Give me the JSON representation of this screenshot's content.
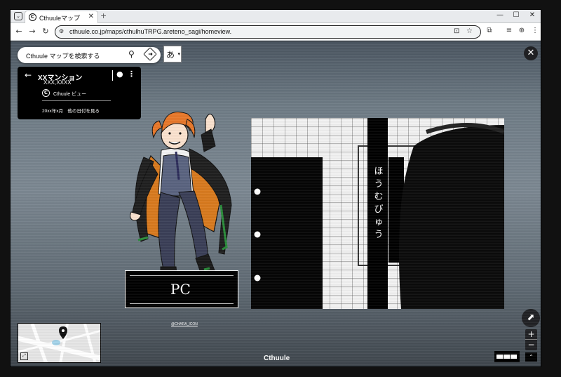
{
  "browser": {
    "tab_title": "Cthuuleマップ",
    "tab_close": "✕",
    "new_tab": "+",
    "url": "cthuule.co.jp/maps/cthulhuTRPG.areteno_sagi/homeview.",
    "window_controls": {
      "minimize": "—",
      "maximize": "☐",
      "close": "✕"
    },
    "nav": {
      "back": "←",
      "forward": "→",
      "reload": "↻"
    }
  },
  "search": {
    "placeholder": "Cthuule マップを検索する"
  },
  "ime": {
    "mode": "あ",
    "arrow": "▾"
  },
  "close_panorama": "✕",
  "info_card": {
    "back": "←",
    "title": "XXマンション",
    "address": "XXX,XXXX",
    "view_label": "Cthuule ビュー",
    "date_text": "20xx年x月　他の日付を見る"
  },
  "standee": {
    "label": "PC"
  },
  "panel": {
    "vertical_text": [
      "ほ",
      "う",
      "む",
      "び",
      "ゅ",
      "う"
    ]
  },
  "credit": "@CHARA_ICON",
  "brand": "Cthuule",
  "zoom": {
    "in": "+",
    "out": "−"
  },
  "compass": "⬈",
  "expand": "⌃",
  "colors": {
    "panel_bg": "#202124",
    "map_road": "#ffffff",
    "map_bg": "#e6e6e6",
    "hair": "#e8782a",
    "coat_lining": "#d97a1e",
    "stripe": "#2a8c3a"
  }
}
